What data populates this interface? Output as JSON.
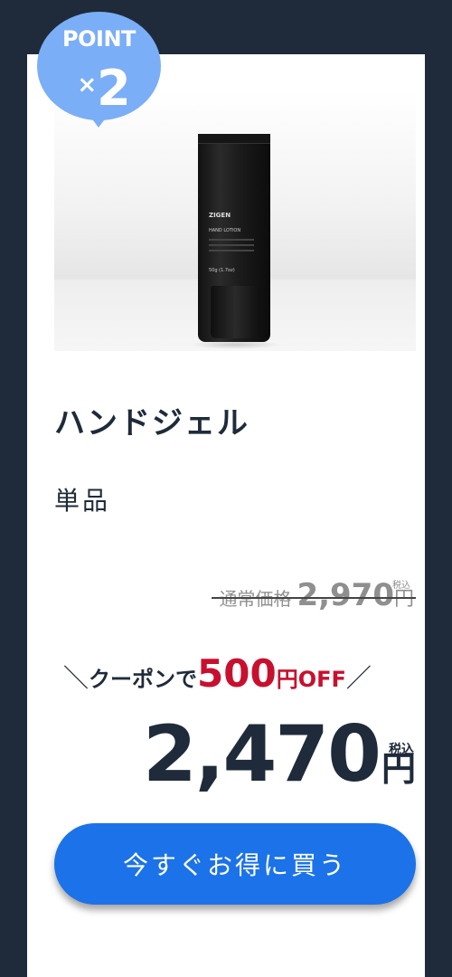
{
  "badge": {
    "label": "POINT",
    "multiplier_sign": "×",
    "multiplier": "2"
  },
  "product": {
    "image_icon": "hand-lotion-tube-photo",
    "tube_brand": "ZIGEN",
    "tube_name": "HAND LOTION",
    "tube_size": "50g (1.7oz)",
    "title": "ハンドジェル",
    "subtitle": "単品"
  },
  "pricing": {
    "regular_label": "通常価格",
    "regular_value": "2,970",
    "regular_yen": "円",
    "regular_tax": "税込",
    "coupon_left": "＼",
    "coupon_label": "クーポンで",
    "coupon_amount": "500",
    "coupon_yen": "円",
    "coupon_off": "OFF",
    "coupon_right": "／",
    "sale_value": "2,470",
    "sale_yen": "円",
    "sale_tax": "税込"
  },
  "cta": {
    "label": "今すぐお得に買う"
  },
  "colors": {
    "background": "#1f2b3a",
    "accent": "#1c72e8",
    "badge": "#7aaef7",
    "discount": "#c8102e"
  }
}
